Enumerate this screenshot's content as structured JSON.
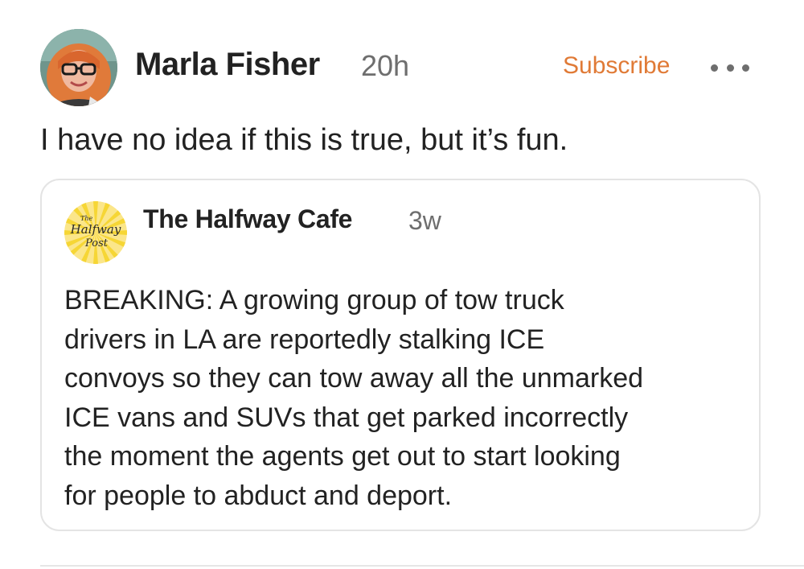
{
  "post": {
    "author": {
      "name": "Marla Fisher",
      "time": "20h"
    },
    "subscribe_label": "Subscribe",
    "text": "I have no idea if this is true, but it’s fun.",
    "quoted_post": {
      "author": {
        "name": "The Halfway Cafe",
        "time": "3w",
        "logo_lines": [
          "The",
          "Halfway",
          "Post"
        ]
      },
      "lines": [
        "BREAKING: A growing group of tow truck",
        "drivers in LA are reportedly stalking ICE",
        "convoys so they can tow away all the unmarked",
        "ICE vans and SUVs that get parked incorrectly",
        "the moment the agents get out to start looking",
        "for people to abduct and deport."
      ]
    }
  },
  "colors": {
    "accent": "#e07a36",
    "text": "#222222",
    "muted": "#6e6e6e",
    "border": "#e4e4e4",
    "logo_yellow": "#f6d635"
  },
  "icons": {
    "more": "ellipsis-horizontal-icon"
  }
}
